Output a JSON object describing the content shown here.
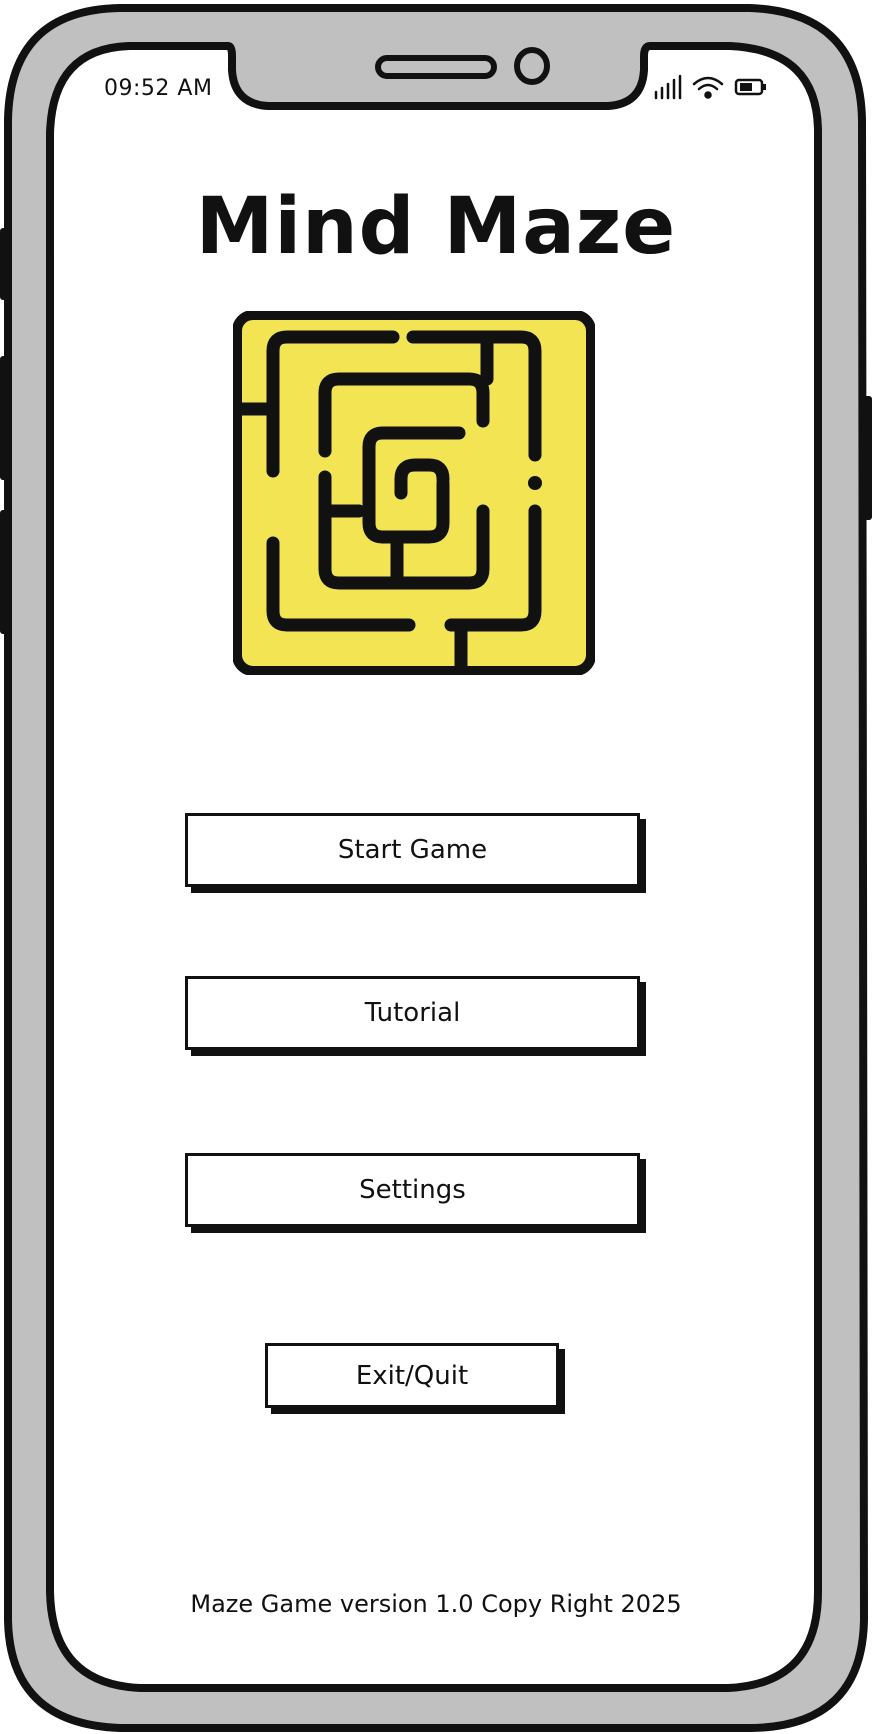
{
  "status_bar": {
    "time": "09:52 AM",
    "signal_icon": "signal-icon",
    "wifi_icon": "wifi-icon",
    "battery_icon": "battery-icon"
  },
  "app": {
    "title": "Mind Maze",
    "logo_icon": "maze-logo-icon",
    "accent_color": "#f2e452"
  },
  "menu": {
    "start_label": "Start Game",
    "tutorial_label": "Tutorial",
    "settings_label": "Settings",
    "exit_label": "Exit/Quit"
  },
  "footer": {
    "text": "Maze Game version 1.0 Copy Right 2025"
  }
}
